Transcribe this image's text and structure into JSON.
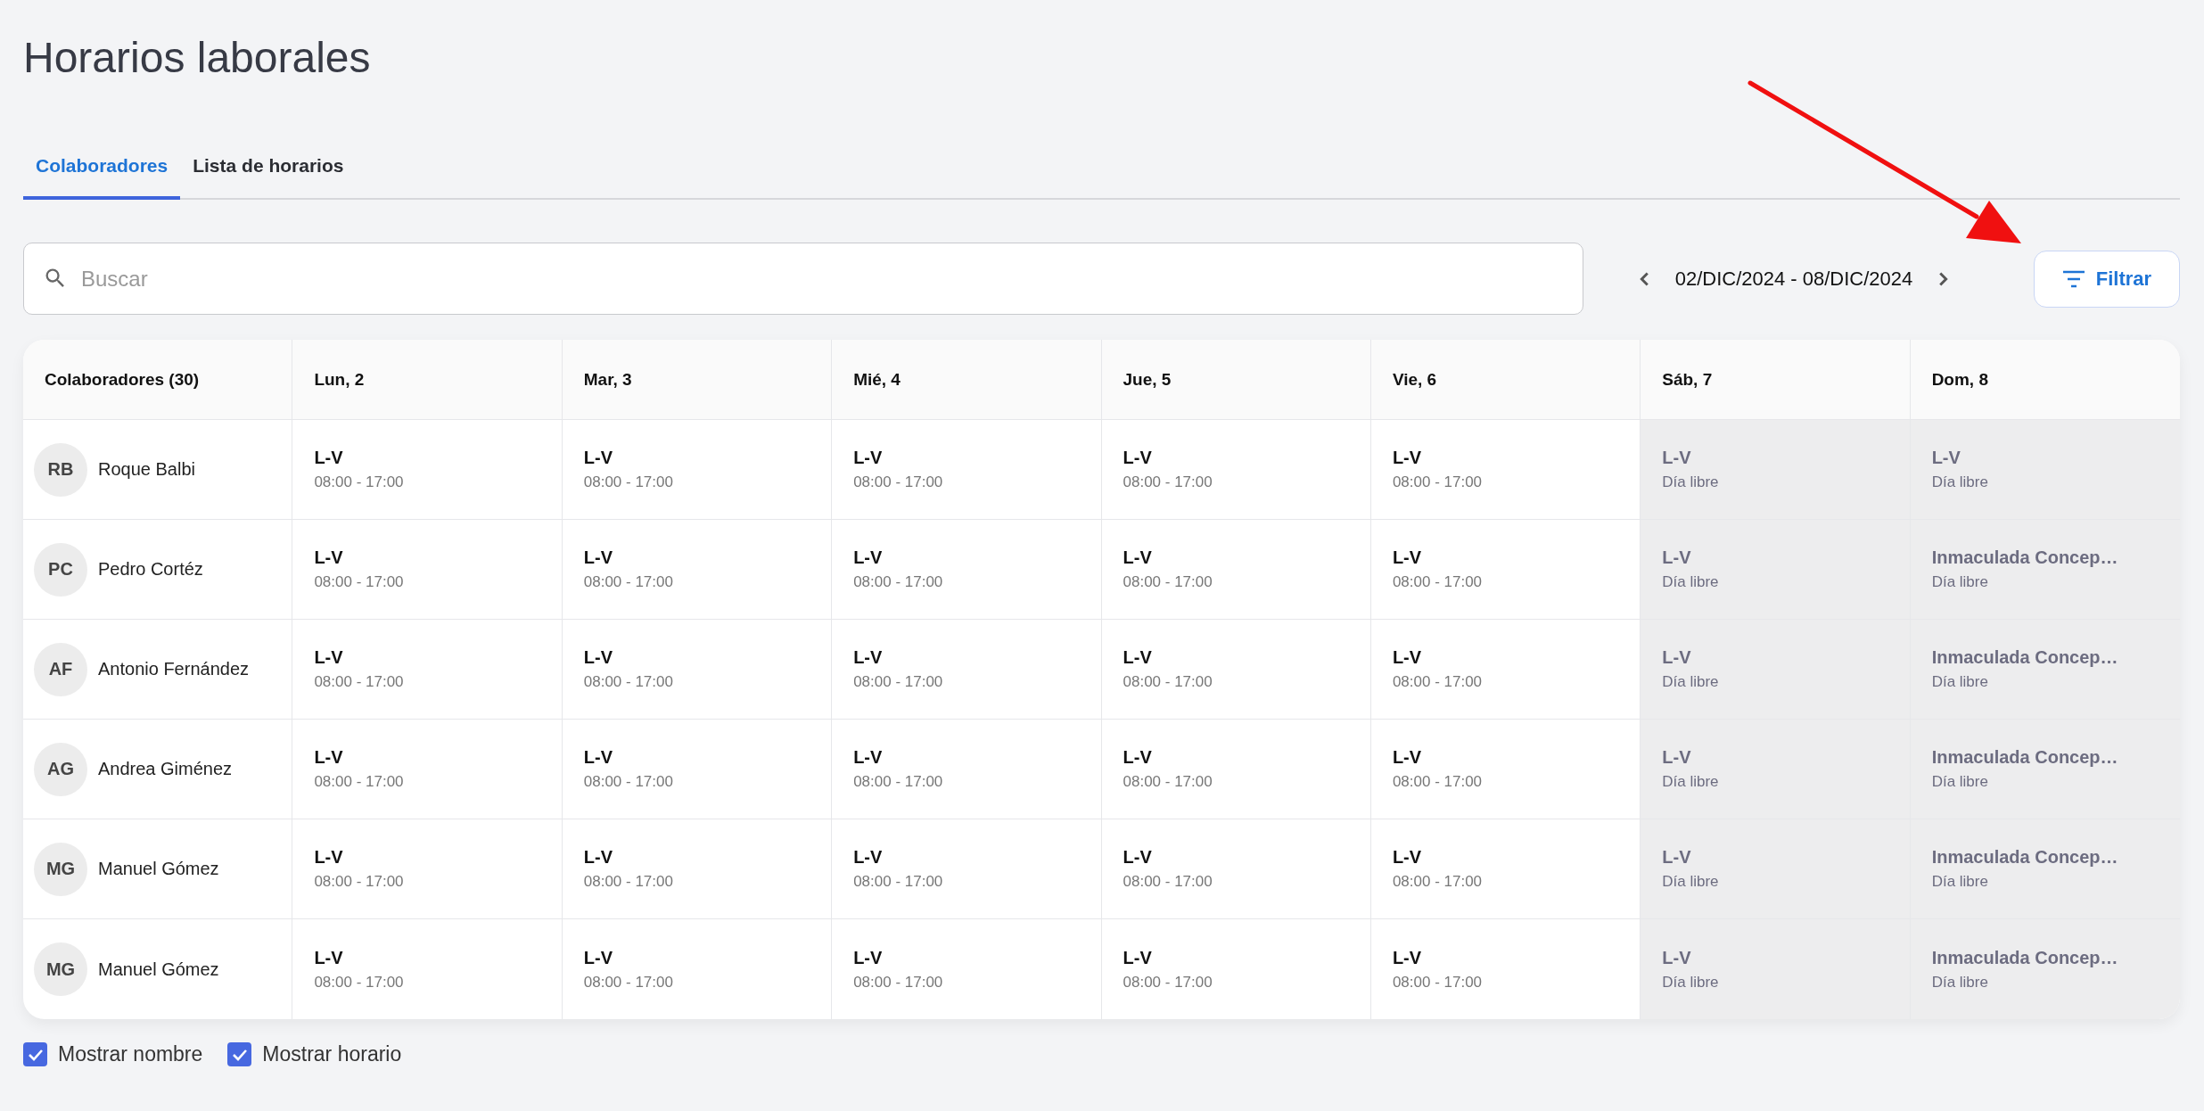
{
  "title": "Horarios laborales",
  "tabs": [
    {
      "label": "Colaboradores",
      "selected": true
    },
    {
      "label": "Lista de horarios",
      "selected": false
    }
  ],
  "search": {
    "placeholder": "Buscar"
  },
  "date_range": "02/DIC/2024 - 08/DIC/2024",
  "filter_button": "Filtrar",
  "table": {
    "columns": [
      "Colaboradores (30)",
      "Lun, 2",
      "Mar, 3",
      "Mié, 4",
      "Jue, 5",
      "Vie, 6",
      "Sáb, 7",
      "Dom, 8"
    ],
    "rows": [
      {
        "cells": [
          {
            "kind": "employee",
            "initials": "RB",
            "name": "Roque Balbi"
          },
          {
            "kind": "shift",
            "shift": "L-V",
            "hours": "08:00 - 17:00",
            "off": false
          },
          {
            "kind": "shift",
            "shift": "L-V",
            "hours": "08:00 - 17:00",
            "off": false
          },
          {
            "kind": "shift",
            "shift": "L-V",
            "hours": "08:00 - 17:00",
            "off": false
          },
          {
            "kind": "shift",
            "shift": "L-V",
            "hours": "08:00 - 17:00",
            "off": false
          },
          {
            "kind": "shift",
            "shift": "L-V",
            "hours": "08:00 - 17:00",
            "off": false
          },
          {
            "kind": "shift",
            "shift": "L-V",
            "hours": "Día libre",
            "off": true
          },
          {
            "kind": "shift",
            "shift": "L-V",
            "hours": "Día libre",
            "off": true
          }
        ]
      },
      {
        "cells": [
          {
            "kind": "employee",
            "initials": "PC",
            "name": "Pedro Cortéz"
          },
          {
            "kind": "shift",
            "shift": "L-V",
            "hours": "08:00 - 17:00",
            "off": false
          },
          {
            "kind": "shift",
            "shift": "L-V",
            "hours": "08:00 - 17:00",
            "off": false
          },
          {
            "kind": "shift",
            "shift": "L-V",
            "hours": "08:00 - 17:00",
            "off": false
          },
          {
            "kind": "shift",
            "shift": "L-V",
            "hours": "08:00 - 17:00",
            "off": false
          },
          {
            "kind": "shift",
            "shift": "L-V",
            "hours": "08:00 - 17:00",
            "off": false
          },
          {
            "kind": "shift",
            "shift": "L-V",
            "hours": "Día libre",
            "off": true
          },
          {
            "kind": "shift",
            "shift": "Inmaculada Concep…",
            "hours": "Día libre",
            "off": true
          }
        ]
      },
      {
        "cells": [
          {
            "kind": "employee",
            "initials": "AF",
            "name": "Antonio Fernández"
          },
          {
            "kind": "shift",
            "shift": "L-V",
            "hours": "08:00 - 17:00",
            "off": false
          },
          {
            "kind": "shift",
            "shift": "L-V",
            "hours": "08:00 - 17:00",
            "off": false
          },
          {
            "kind": "shift",
            "shift": "L-V",
            "hours": "08:00 - 17:00",
            "off": false
          },
          {
            "kind": "shift",
            "shift": "L-V",
            "hours": "08:00 - 17:00",
            "off": false
          },
          {
            "kind": "shift",
            "shift": "L-V",
            "hours": "08:00 - 17:00",
            "off": false
          },
          {
            "kind": "shift",
            "shift": "L-V",
            "hours": "Día libre",
            "off": true
          },
          {
            "kind": "shift",
            "shift": "Inmaculada Concep…",
            "hours": "Día libre",
            "off": true
          }
        ]
      },
      {
        "cells": [
          {
            "kind": "employee",
            "initials": "AG",
            "name": "Andrea Giménez"
          },
          {
            "kind": "shift",
            "shift": "L-V",
            "hours": "08:00 - 17:00",
            "off": false
          },
          {
            "kind": "shift",
            "shift": "L-V",
            "hours": "08:00 - 17:00",
            "off": false
          },
          {
            "kind": "shift",
            "shift": "L-V",
            "hours": "08:00 - 17:00",
            "off": false
          },
          {
            "kind": "shift",
            "shift": "L-V",
            "hours": "08:00 - 17:00",
            "off": false
          },
          {
            "kind": "shift",
            "shift": "L-V",
            "hours": "08:00 - 17:00",
            "off": false
          },
          {
            "kind": "shift",
            "shift": "L-V",
            "hours": "Día libre",
            "off": true
          },
          {
            "kind": "shift",
            "shift": "Inmaculada Concep…",
            "hours": "Día libre",
            "off": true
          }
        ]
      },
      {
        "cells": [
          {
            "kind": "employee",
            "initials": "MG",
            "name": "Manuel Gómez"
          },
          {
            "kind": "shift",
            "shift": "L-V",
            "hours": "08:00 - 17:00",
            "off": false
          },
          {
            "kind": "shift",
            "shift": "L-V",
            "hours": "08:00 - 17:00",
            "off": false
          },
          {
            "kind": "shift",
            "shift": "L-V",
            "hours": "08:00 - 17:00",
            "off": false
          },
          {
            "kind": "shift",
            "shift": "L-V",
            "hours": "08:00 - 17:00",
            "off": false
          },
          {
            "kind": "shift",
            "shift": "L-V",
            "hours": "08:00 - 17:00",
            "off": false
          },
          {
            "kind": "shift",
            "shift": "L-V",
            "hours": "Día libre",
            "off": true
          },
          {
            "kind": "shift",
            "shift": "Inmaculada Concep…",
            "hours": "Día libre",
            "off": true
          }
        ]
      },
      {
        "cells": [
          {
            "kind": "employee",
            "initials": "MG",
            "name": "Manuel Gómez"
          },
          {
            "kind": "shift",
            "shift": "L-V",
            "hours": "08:00 - 17:00",
            "off": false
          },
          {
            "kind": "shift",
            "shift": "L-V",
            "hours": "08:00 - 17:00",
            "off": false
          },
          {
            "kind": "shift",
            "shift": "L-V",
            "hours": "08:00 - 17:00",
            "off": false
          },
          {
            "kind": "shift",
            "shift": "L-V",
            "hours": "08:00 - 17:00",
            "off": false
          },
          {
            "kind": "shift",
            "shift": "L-V",
            "hours": "08:00 - 17:00",
            "off": false
          },
          {
            "kind": "shift",
            "shift": "L-V",
            "hours": "Día libre",
            "off": true
          },
          {
            "kind": "shift",
            "shift": "Inmaculada Concep…",
            "hours": "Día libre",
            "off": true
          }
        ]
      }
    ]
  },
  "options": [
    {
      "label": "Mostrar nombre",
      "checked": true
    },
    {
      "label": "Mostrar horario",
      "checked": true
    }
  ]
}
